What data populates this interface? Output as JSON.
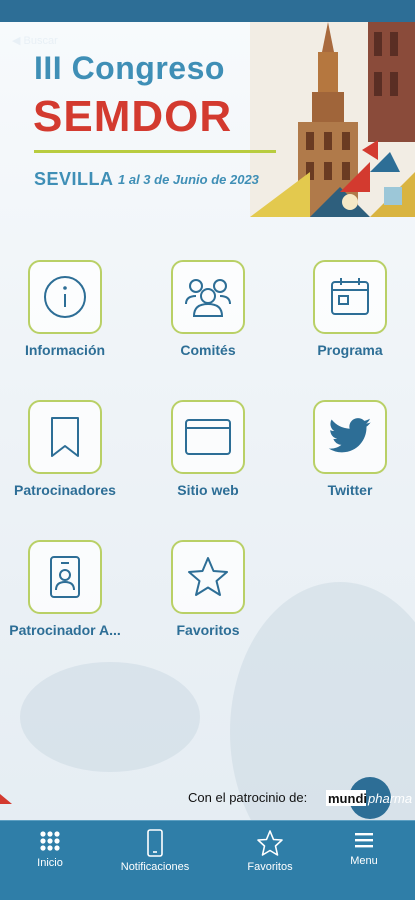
{
  "header": {
    "back_label": "Buscar",
    "title_line1": "III Congreso",
    "title_line2": "SEMDOR",
    "city": "SEVILLA",
    "dates": "1 al 3 de Junio de 2023"
  },
  "menu": {
    "items": [
      {
        "label": "Información",
        "icon": "info-icon"
      },
      {
        "label": "Comités",
        "icon": "people-icon"
      },
      {
        "label": "Programa",
        "icon": "calendar-icon"
      },
      {
        "label": "Patrocinadores",
        "icon": "bookmark-icon"
      },
      {
        "label": "Sitio web",
        "icon": "browser-window-icon"
      },
      {
        "label": "Twitter",
        "icon": "twitter-bird-icon"
      },
      {
        "label": "Patrocinador A...",
        "icon": "id-badge-icon"
      },
      {
        "label": "Favoritos",
        "icon": "star-icon"
      }
    ]
  },
  "sponsor": {
    "text": "Con el patrocinio de:",
    "brand_part1": "mundi",
    "brand_part2": "pharma"
  },
  "tabbar": {
    "items": [
      {
        "label": "Inicio",
        "icon": "grid-dots-icon"
      },
      {
        "label": "Notificaciones",
        "icon": "phone-icon"
      },
      {
        "label": "Favoritos",
        "icon": "star-icon"
      },
      {
        "label": "Menu",
        "icon": "hamburger-icon"
      }
    ]
  },
  "colors": {
    "brand_blue": "#3f8fb6",
    "brand_red": "#d33a2f",
    "accent_green": "#b9d066",
    "tabbar_bg": "#2f7ea8"
  }
}
